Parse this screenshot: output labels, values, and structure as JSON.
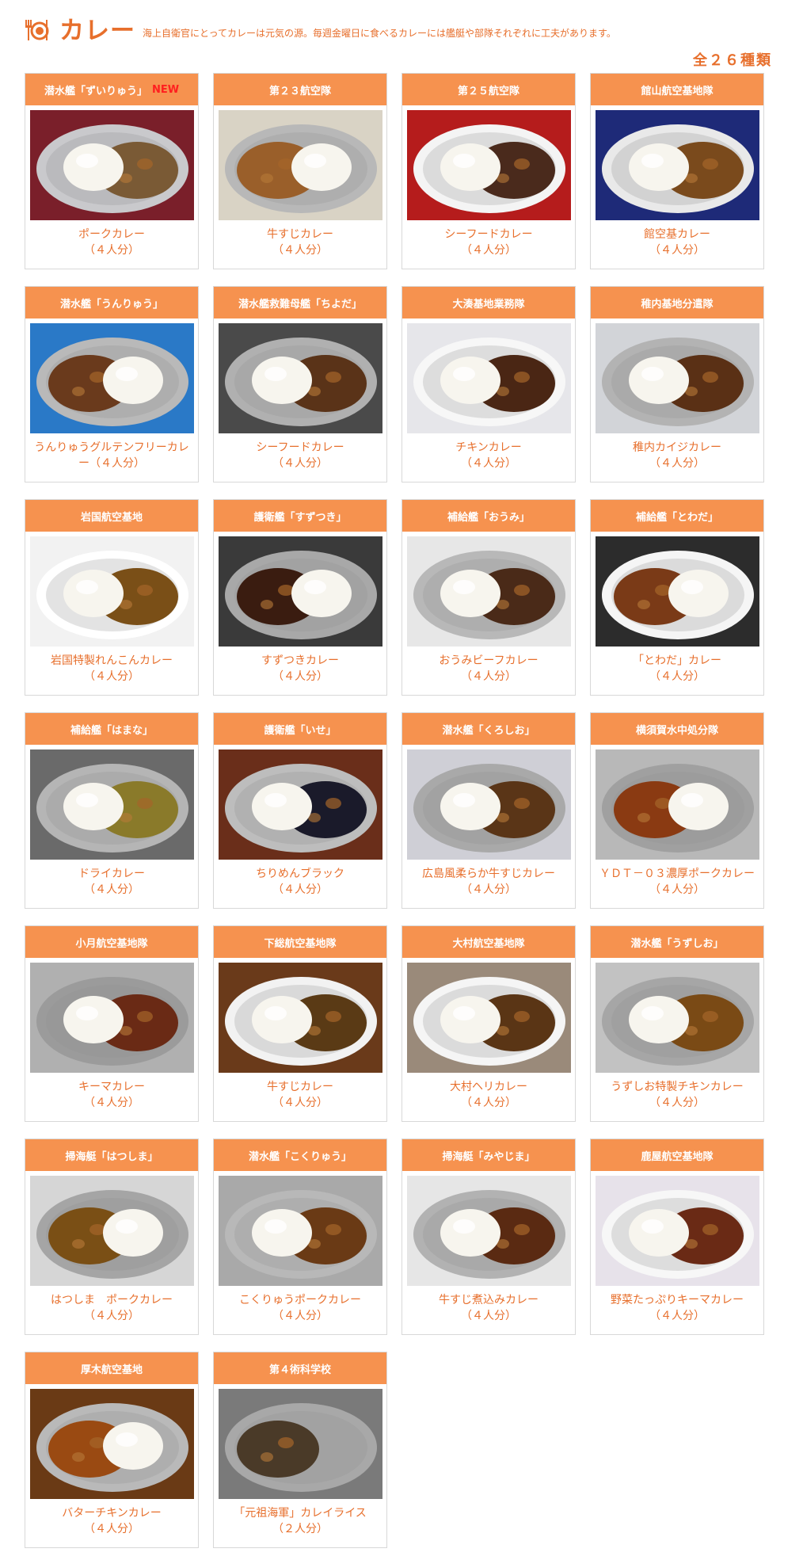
{
  "header": {
    "title": "カレー",
    "description": "海上自衛官にとってカレーは元気の源。毎週金曜日に食べるカレーには艦艇や部隊それぞれに工夫があります。",
    "count": "全２６種類",
    "icon": "fork-plate-icon"
  },
  "colors": {
    "accent": "#f6924f",
    "text_accent": "#e76f2c",
    "new_badge": "#ff1f1f"
  },
  "cards": [
    {
      "unit": "潜水艦「ずいりゅう」",
      "new": "NEW",
      "name": "ポークカレー",
      "servings": "（４人分）",
      "photo": {
        "bg": "#7a1f2a",
        "plate": "#c9c9cc",
        "rice_side": "left",
        "curry": "#7a5a35"
      }
    },
    {
      "unit": "第２３航空隊",
      "new": "",
      "name": "牛すじカレー",
      "servings": "（４人分）",
      "photo": {
        "bg": "#d9d3c5",
        "plate": "#b8b8b8",
        "rice_side": "right",
        "curry": "#9a5f2a"
      }
    },
    {
      "unit": "第２５航空隊",
      "new": "",
      "name": "シーフードカレー",
      "servings": "（４人分）",
      "photo": {
        "bg": "#b51c1c",
        "plate": "#f4f4f4",
        "rice_side": "left",
        "curry": "#4a2a1c"
      }
    },
    {
      "unit": "館山航空基地隊",
      "new": "",
      "name": "館空基カレー",
      "servings": "（４人分）",
      "photo": {
        "bg": "#1e2a78",
        "plate": "#e9e9e9",
        "rice_side": "left",
        "curry": "#7a4a1c"
      }
    },
    {
      "unit": "潜水艦「うんりゅう」",
      "new": "",
      "name": "うんりゅうグルテンフリーカレー（４人分）",
      "servings": "",
      "photo": {
        "bg": "#2a79c7",
        "plate": "#b9b9b9",
        "rice_side": "right",
        "curry": "#6a3a1c"
      }
    },
    {
      "unit": "潜水艦救難母艦「ちよだ」",
      "new": "",
      "name": "シーフードカレー",
      "servings": "（４人分）",
      "photo": {
        "bg": "#4a4a4a",
        "plate": "#b0b0b0",
        "rice_side": "left",
        "curry": "#5a3318"
      }
    },
    {
      "unit": "大湊基地業務隊",
      "new": "",
      "name": "チキンカレー",
      "servings": "（４人分）",
      "photo": {
        "bg": "#e6e6ea",
        "plate": "#f7f7f7",
        "rice_side": "left",
        "curry": "#4a2614"
      }
    },
    {
      "unit": "稚内基地分遣隊",
      "new": "",
      "name": "稚内カイジカレー",
      "servings": "（４人分）",
      "photo": {
        "bg": "#d2d4d8",
        "plate": "#b3b3b3",
        "rice_side": "left",
        "curry": "#5a3015"
      }
    },
    {
      "unit": "岩国航空基地",
      "new": "",
      "name": "岩国特製れんこんカレー",
      "servings": "（４人分）",
      "photo": {
        "bg": "#f2f2f2",
        "plate": "#ffffff",
        "rice_side": "left",
        "curry": "#7a4f17"
      }
    },
    {
      "unit": "護衛艦「すずつき」",
      "new": "",
      "name": "すずつきカレー",
      "servings": "（４人分）",
      "photo": {
        "bg": "#3a3a3a",
        "plate": "#a8a8a8",
        "rice_side": "right",
        "curry": "#3a1c10"
      }
    },
    {
      "unit": "補給艦「おうみ」",
      "new": "",
      "name": "おうみビーフカレー",
      "servings": "（４人分）",
      "photo": {
        "bg": "#e7e7e7",
        "plate": "#b8b8b8",
        "rice_side": "left",
        "curry": "#4a2a18"
      }
    },
    {
      "unit": "補給艦「とわだ」",
      "new": "",
      "name": "「とわだ」カレー",
      "servings": "（４人分）",
      "photo": {
        "bg": "#2c2c2c",
        "plate": "#f5f5f5",
        "rice_side": "right",
        "curry": "#7a3a17"
      }
    },
    {
      "unit": "補給艦「はまな」",
      "new": "",
      "name": "ドライカレー",
      "servings": "（４人分）",
      "photo": {
        "bg": "#6a6a6a",
        "plate": "#b5b5b5",
        "rice_side": "left",
        "curry": "#8a7a2a"
      }
    },
    {
      "unit": "護衛艦「いせ」",
      "new": "",
      "name": "ちりめんブラック",
      "servings": "（４人分）",
      "photo": {
        "bg": "#6a2e1a",
        "plate": "#bdbdbd",
        "rice_side": "left",
        "curry": "#1a1a2a"
      }
    },
    {
      "unit": "潜水艦「くろしお」",
      "new": "",
      "name": "広島風柔らか牛すじカレー",
      "servings": "（４人分）",
      "photo": {
        "bg": "#cfcfd6",
        "plate": "#a9a9a9",
        "rice_side": "left",
        "curry": "#5a3517"
      }
    },
    {
      "unit": "横須賀水中処分隊",
      "new": "",
      "name": "ＹＤＴ－０３濃厚ポークカレー",
      "servings": "（４人分）",
      "photo": {
        "bg": "#b8b8b8",
        "plate": "#a0a0a0",
        "rice_side": "right",
        "curry": "#8a3a12"
      }
    },
    {
      "unit": "小月航空基地隊",
      "new": "",
      "name": "キーマカレー",
      "servings": "（４人分）",
      "photo": {
        "bg": "#b0b0b0",
        "plate": "#9b9b9b",
        "rice_side": "left",
        "curry": "#6a2a15"
      }
    },
    {
      "unit": "下総航空基地隊",
      "new": "",
      "name": "牛すじカレー",
      "servings": "（４人分）",
      "photo": {
        "bg": "#6a3a1a",
        "plate": "#f2f2f2",
        "rice_side": "left",
        "curry": "#5a3a15"
      }
    },
    {
      "unit": "大村航空基地隊",
      "new": "",
      "name": "大村ヘリカレー",
      "servings": "（４人分）",
      "photo": {
        "bg": "#9a8a7a",
        "plate": "#f5f5f5",
        "rice_side": "left",
        "curry": "#5a3515"
      }
    },
    {
      "unit": "潜水艦「うずしお」",
      "new": "",
      "name": "うずしお特製チキンカレー",
      "servings": "（４人分）",
      "photo": {
        "bg": "#c2c2c2",
        "plate": "#a6a6a6",
        "rice_side": "left",
        "curry": "#7a4a15"
      }
    },
    {
      "unit": "掃海艇「はつしま」",
      "new": "",
      "name": "はつしま　ポークカレー",
      "servings": "（４人分）",
      "photo": {
        "bg": "#d6d6d6",
        "plate": "#a5a5a5",
        "rice_side": "right",
        "curry": "#7a4f15"
      }
    },
    {
      "unit": "潜水艦「こくりゅう」",
      "new": "",
      "name": "こくりゅうポークカレー",
      "servings": "（４人分）",
      "photo": {
        "bg": "#a9a9a9",
        "plate": "#b8b8b8",
        "rice_side": "left",
        "curry": "#6a3a15"
      }
    },
    {
      "unit": "掃海艇「みやじま」",
      "new": "",
      "name": "牛すじ煮込みカレー",
      "servings": "（４人分）",
      "photo": {
        "bg": "#e6e6e6",
        "plate": "#b2b2b2",
        "rice_side": "left",
        "curry": "#5a2a12"
      }
    },
    {
      "unit": "鹿屋航空基地隊",
      "new": "",
      "name": "野菜たっぷりキーマカレー",
      "servings": "（４人分）",
      "photo": {
        "bg": "#e7e2ea",
        "plate": "#f7f7f7",
        "rice_side": "left",
        "curry": "#6a2a15"
      }
    },
    {
      "unit": "厚木航空基地",
      "new": "",
      "name": "バターチキンカレー",
      "servings": "（４人分）",
      "photo": {
        "bg": "#6a3a15",
        "plate": "#b9b9b9",
        "rice_side": "right",
        "curry": "#9a4a12"
      }
    },
    {
      "unit": "第４術科学校",
      "new": "",
      "name": "「元祖海軍」カレイライス",
      "servings": "（２人分）",
      "photo": {
        "bg": "#7a7a7a",
        "plate": "#a8a8a8",
        "rice_side": "none",
        "curry": "#4a3a28"
      }
    }
  ]
}
